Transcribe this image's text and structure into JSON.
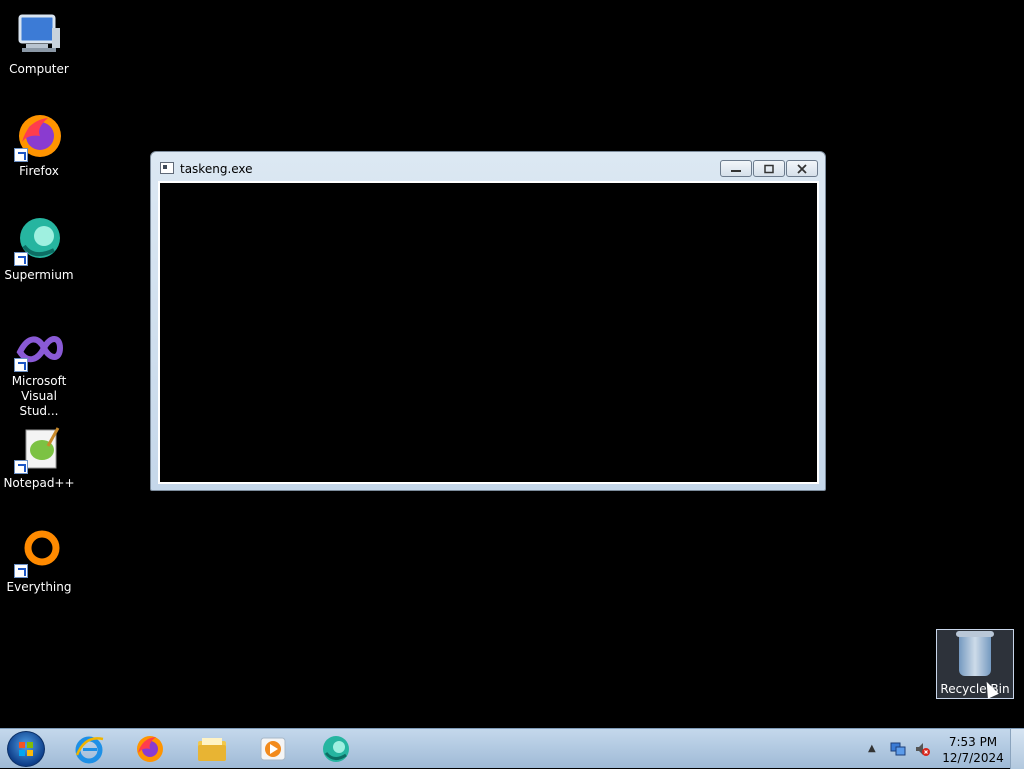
{
  "desktop": {
    "icons": [
      {
        "label": "Computer",
        "icon": "computer-icon"
      },
      {
        "label": "Firefox",
        "icon": "firefox-icon"
      },
      {
        "label": "Supermium",
        "icon": "supermium-icon"
      },
      {
        "label": "Microsoft\nVisual Stud...",
        "icon": "visual-studio-icon"
      },
      {
        "label": "Notepad++",
        "icon": "notepadpp-icon"
      },
      {
        "label": "Everything",
        "icon": "everything-icon"
      }
    ],
    "recycle_bin": {
      "label": "Recycle Bin",
      "icon": "recycle-bin-icon"
    }
  },
  "window": {
    "title": "taskeng.exe",
    "buttons": {
      "minimize": "minimize-icon",
      "maximize": "maximize-icon",
      "close": "close-icon"
    }
  },
  "taskbar": {
    "pinned": [
      "internet-explorer-icon",
      "firefox-icon",
      "file-explorer-icon",
      "media-player-icon",
      "supermium-icon"
    ],
    "tray": {
      "icons": [
        "show-hidden-icons-icon",
        "network-icon",
        "volume-muted-icon"
      ],
      "time": "7:53 PM",
      "date": "12/7/2024"
    }
  },
  "colors": {
    "desktop_bg": "#000000",
    "taskbar_top": "#c4d8ec",
    "taskbar_bottom": "#9fbad6",
    "window_frame": "#c5d7ea"
  }
}
